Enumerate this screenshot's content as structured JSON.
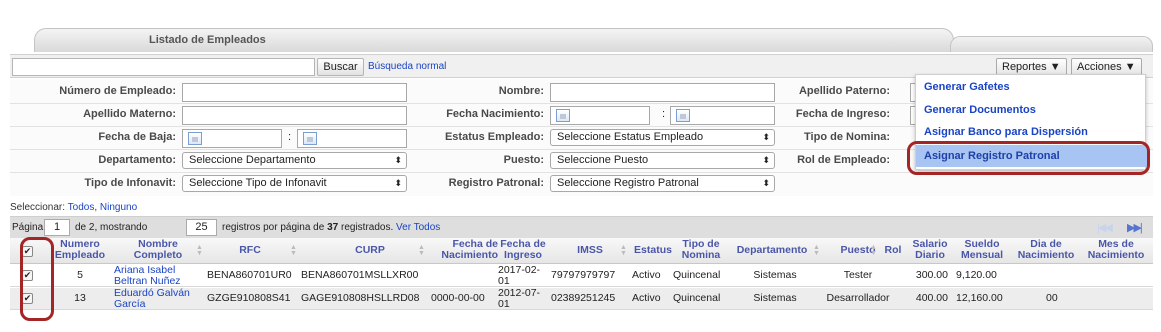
{
  "panel": {
    "title": "Listado de Empleados"
  },
  "search": {
    "button": "Buscar",
    "link": "Búsqueda normal"
  },
  "toolbar": {
    "reportes": "Reportes ▼",
    "acciones": "Acciones ▼"
  },
  "filters": {
    "numero_empleado": "Número de Empleado:",
    "nombre": "Nombre:",
    "apellido_paterno": "Apellido Paterno:",
    "apellido_materno": "Apellido Materno:",
    "fecha_nacimiento": "Fecha Nacimiento:",
    "fecha_ingreso": "Fecha de Ingreso:",
    "fecha_baja": "Fecha de Baja:",
    "estatus_empleado": "Estatus Empleado:",
    "estatus_empleado_value": "Seleccione Estatus Empleado",
    "tipo_nomina": "Tipo de Nomina:",
    "departamento": "Departamento:",
    "departamento_value": "Seleccione Departamento",
    "puesto": "Puesto:",
    "puesto_value": "Seleccione Puesto",
    "rol_empleado": "Rol de Empleado:",
    "tipo_infonavit": "Tipo de Infonavit:",
    "tipo_infonavit_value": "Seleccione Tipo de Infonavit",
    "registro_patronal": "Registro Patronal:",
    "registro_patronal_value": "Seleccione Registro Patronal",
    "colon": ":"
  },
  "selection": {
    "label": "Seleccionar:",
    "all": "Todos",
    "comma": ",",
    "none": "Ninguno"
  },
  "pager": {
    "page_label": "Página",
    "page_value": "1",
    "of_text": "de 2, mostrando",
    "per_page": "25",
    "registros_text": "registros por página de",
    "total": "37",
    "registrados": "registrados.",
    "ver_todos": "Ver Todos",
    "first_icon": "|◀◀",
    "last_icon": "▶▶|"
  },
  "dropdown": {
    "items": [
      "Generar Gafetes",
      "Generar Documentos",
      "Asignar Banco para Dispersión",
      "Asignar Registro Patronal"
    ]
  },
  "table": {
    "headers": {
      "numero": [
        "Numero",
        "Empleado"
      ],
      "nombre": [
        "Nombre",
        "Completo"
      ],
      "rfc": "RFC",
      "curp": "CURP",
      "fecha_nac": [
        "Fecha de",
        "Nacimiento"
      ],
      "fecha_ing": [
        "Fecha de",
        "Ingreso"
      ],
      "imss": "IMSS",
      "estatus": "Estatus",
      "tipo_nomina": [
        "Tipo de",
        "Nomina"
      ],
      "departamento": "Departamento",
      "puesto": "Puesto",
      "rol": "Rol",
      "salario": [
        "Salario",
        "Diario"
      ],
      "sueldo": [
        "Sueldo",
        "Mensual"
      ],
      "dia_nac": [
        "Dia de",
        "Nacimiento"
      ],
      "mes_nac": [
        "Mes de",
        "Nacimiento"
      ]
    },
    "rows": [
      {
        "numero": "5",
        "nombre": [
          "Ariana Isabel",
          "Beltran Nuñez"
        ],
        "rfc": "BENA860701UR0",
        "curp": "BENA860701MSLLXR00",
        "fecha_nac": "",
        "fecha_ing": [
          "2017-02-",
          "01"
        ],
        "imss": "79797979797",
        "estatus": "Activo",
        "tipo_nomina": "Quincenal",
        "departamento": "Sistemas",
        "puesto": "Tester",
        "salario": "300.00",
        "sueldo": "9,120.00",
        "dia_nac": "",
        "mes_nac": ""
      },
      {
        "numero": "13",
        "nombre": [
          "Eduardó Galván",
          "García"
        ],
        "rfc": "GZGE910808S41",
        "curp": "GAGE910808HSLLRD08",
        "fecha_nac": "0000-00-00",
        "fecha_ing": [
          "2012-07-",
          "01"
        ],
        "imss": "02389251245",
        "estatus": "Activo",
        "tipo_nomina": "Quincenal",
        "departamento": "Sistemas",
        "puesto": "Desarrollador",
        "salario": "400.00",
        "sueldo": "12,160.00",
        "dia_nac": "00",
        "mes_nac": ""
      }
    ]
  },
  "colors": {
    "link": "#1a44c4",
    "highlight": "#a7c4f2",
    "annotation": "#a32525"
  }
}
